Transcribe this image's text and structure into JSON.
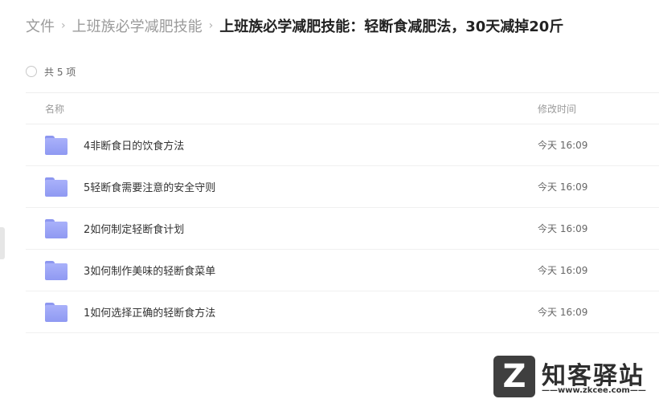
{
  "breadcrumb": {
    "items": [
      "文件",
      "上班族必学减肥技能"
    ],
    "separator": "›",
    "current": "上班族必学减肥技能：轻断食减肥法，30天减掉20斤"
  },
  "selection": {
    "count_label": "共 5 项"
  },
  "list": {
    "columns": {
      "name": "名称",
      "modified": "修改时间"
    },
    "rows": [
      {
        "name": "4非断食日的饮食方法",
        "modified": "今天 16:09",
        "icon": "folder-icon"
      },
      {
        "name": "5轻断食需要注意的安全守则",
        "modified": "今天 16:09",
        "icon": "folder-icon"
      },
      {
        "name": "2如何制定轻断食计划",
        "modified": "今天 16:09",
        "icon": "folder-icon"
      },
      {
        "name": "3如何制作美味的轻断食菜单",
        "modified": "今天 16:09",
        "icon": "folder-icon"
      },
      {
        "name": "1如何选择正确的轻断食方法",
        "modified": "今天 16:09",
        "icon": "folder-icon"
      }
    ]
  },
  "watermark": {
    "logo_letter": "Z",
    "title": "知客驿站",
    "url": "——www.zkcee.com——"
  },
  "colors": {
    "folder": "#9aa3f6",
    "breadcrumb_muted": "#9a9a9a",
    "breadcrumb_current": "#222222"
  }
}
